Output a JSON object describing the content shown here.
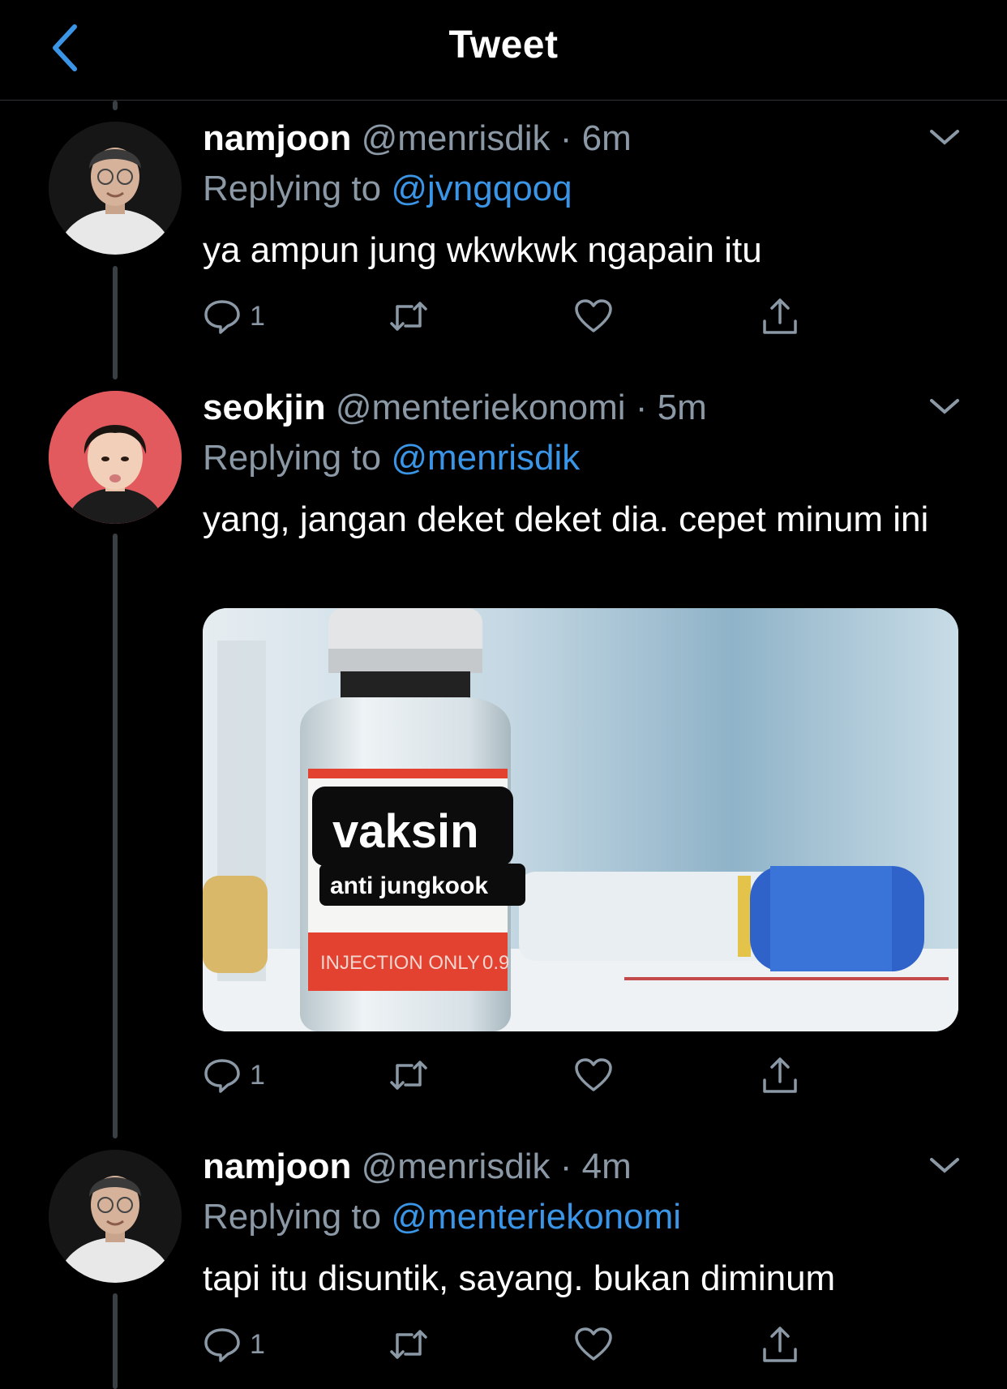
{
  "header": {
    "title": "Tweet"
  },
  "tweets": [
    {
      "name": "namjoon",
      "handle": "@menrisdik",
      "dot": "·",
      "time": "6m",
      "replying_prefix": "Replying to ",
      "replying_to": "@jvngqooq",
      "text": "ya ampun jung wkwkwk ngapain itu",
      "reply_count": "1"
    },
    {
      "name": "seokjin",
      "handle": "@menteriekonomi",
      "dot": "·",
      "time": "5m",
      "replying_prefix": "Replying to ",
      "replying_to": "@menrisdik",
      "text": "yang, jangan deket deket dia. cepet minum ini",
      "reply_count": "1",
      "media": {
        "sticker_title": "vaksin",
        "sticker_sub": "anti jungkook",
        "label_text": "INJECTION ONLY",
        "label_num": "0.9"
      }
    },
    {
      "name": "namjoon",
      "handle": "@menrisdik",
      "dot": "·",
      "time": "4m",
      "replying_prefix": "Replying to ",
      "replying_to": "@menteriekonomi",
      "text": "tapi itu disuntik, sayang. bukan diminum",
      "reply_count": "1"
    }
  ],
  "colors": {
    "accent": "#3b95e6",
    "muted": "#8b98a5",
    "background": "#000000"
  },
  "icons": [
    "chevron-left-icon",
    "reply-icon",
    "retweet-icon",
    "like-icon",
    "share-icon",
    "chevron-down-icon"
  ]
}
